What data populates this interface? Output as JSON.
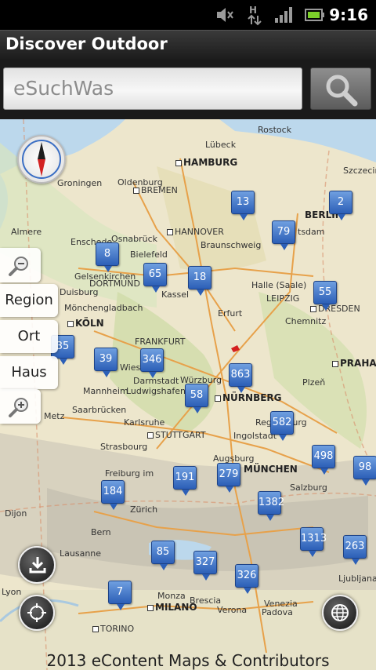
{
  "status": {
    "time": "9:16"
  },
  "app": {
    "title": "Discover Outdoor"
  },
  "search": {
    "placeholder": "eSuchWas"
  },
  "side_buttons": {
    "region": "Region",
    "ort": "Ort",
    "haus": "Haus"
  },
  "map": {
    "copyright": "2013 eContent Maps & Contributors",
    "cities": [
      "Rostock",
      "Lübeck",
      "Szczecin",
      "HAMBURG",
      "Groningen",
      "Oldenburg",
      "BREMEN",
      "BERLIN",
      "tsdam",
      "Enschede",
      "Osnabrück",
      "HANNOVER",
      "Braunschweig",
      "Almere",
      "Bielefeld",
      "Gelsenkirchen",
      "DORTMUND",
      "Halle (Saale)",
      "Kassel",
      "Duisburg",
      "LEIPZIG",
      "Mönchengladbach",
      "DRESDEN",
      "Chemnitz",
      "Erfurt",
      "KÖLN",
      "FRANKFURT",
      "PRAHA",
      "Wiesba",
      "Darmstadt",
      "Würzburg",
      "Mannheim",
      "Ludwigshafen",
      "Plzeň",
      "Saarbrücken",
      "NÜRNBERG",
      "Metz",
      "Karlsruhe",
      "Regensburg",
      "Ingolstadt",
      "STUTTGART",
      "Strasbourg",
      "Augsburg",
      "MÜNCHEN",
      "Freiburg im",
      "Salzburg",
      "Dijon",
      "Zürich",
      "Bern",
      "Lausanne",
      "Ljubljana",
      "Lyon",
      "Monza",
      "MILANO",
      "Brescia",
      "Verona",
      "Padova",
      "Venezia",
      "TORINO"
    ],
    "markers": [
      "13",
      "2",
      "79",
      "8",
      "65",
      "18",
      "55",
      "35",
      "39",
      "346",
      "863",
      "58",
      "582",
      "498",
      "98",
      "191",
      "279",
      "184",
      "1382",
      "1313",
      "263",
      "85",
      "327",
      "326",
      "7"
    ]
  },
  "colors": {
    "marker": "#3b6fc6",
    "accent": "#1d4286"
  },
  "icons": {
    "search": "search-icon",
    "zoom_in": "zoom-in-icon",
    "zoom_out": "zoom-out-icon",
    "download": "download-icon",
    "locate": "crosshair-icon",
    "globe": "globe-icon",
    "compass": "compass-icon"
  }
}
